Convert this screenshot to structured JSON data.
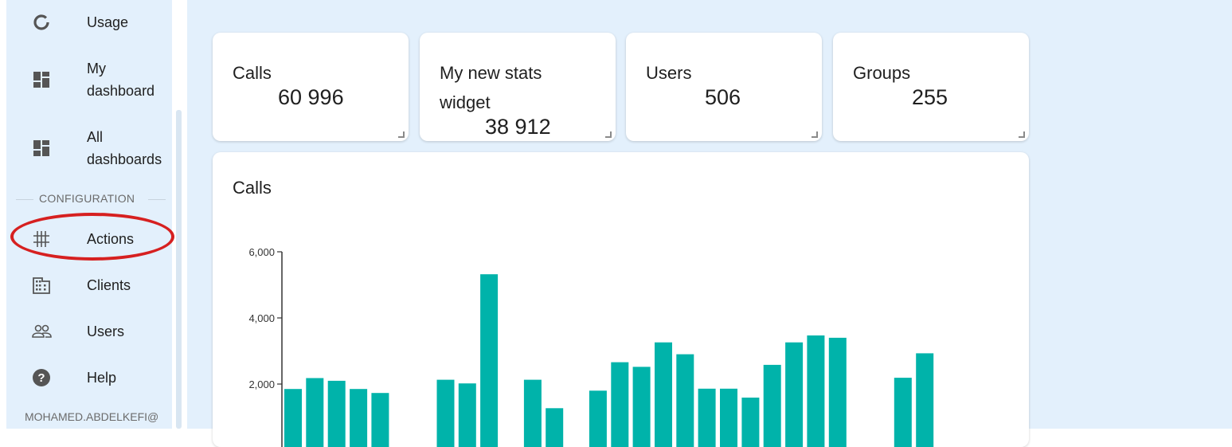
{
  "sidebar": {
    "items_top": [
      {
        "label": "Usage",
        "icon": "usage-ring-icon"
      },
      {
        "label": "My\ndashboard",
        "icon": "dashboard-icon"
      },
      {
        "label": "All\ndashboards",
        "icon": "dashboard-icon"
      }
    ],
    "section_label": "CONFIGURATION",
    "items_config": [
      {
        "label": "Actions",
        "icon": "grid-hash-icon"
      },
      {
        "label": "Clients",
        "icon": "building-icon"
      },
      {
        "label": "Users",
        "icon": "users-icon"
      },
      {
        "label": "Help",
        "icon": "help-icon"
      }
    ],
    "user": "MOHAMED.ABDELKEFI@"
  },
  "stats": [
    {
      "title": "Calls",
      "value": "60 996"
    },
    {
      "title": "My new stats widget",
      "value": "38 912"
    },
    {
      "title": "Users",
      "value": "506"
    },
    {
      "title": "Groups",
      "value": "255"
    }
  ],
  "chart_data": {
    "type": "bar",
    "title": "Calls",
    "xlabel": "",
    "ylabel": "",
    "ylim": [
      0,
      6000
    ],
    "yticks": [
      "2,000",
      "4,000",
      "6,000"
    ],
    "grid": false,
    "color": "#00b3aa",
    "values": [
      1850,
      2180,
      2100,
      1850,
      1730,
      null,
      null,
      2130,
      2020,
      5320,
      50,
      2130,
      1270,
      null,
      1800,
      2660,
      2520,
      3260,
      2900,
      1860,
      1860,
      1590,
      2580,
      3260,
      3470,
      3400,
      null,
      null,
      2190,
      2930
    ]
  },
  "colors": {
    "accent": "#00b3aa",
    "background": "#e3f0fc",
    "highlight": "#d62020"
  }
}
